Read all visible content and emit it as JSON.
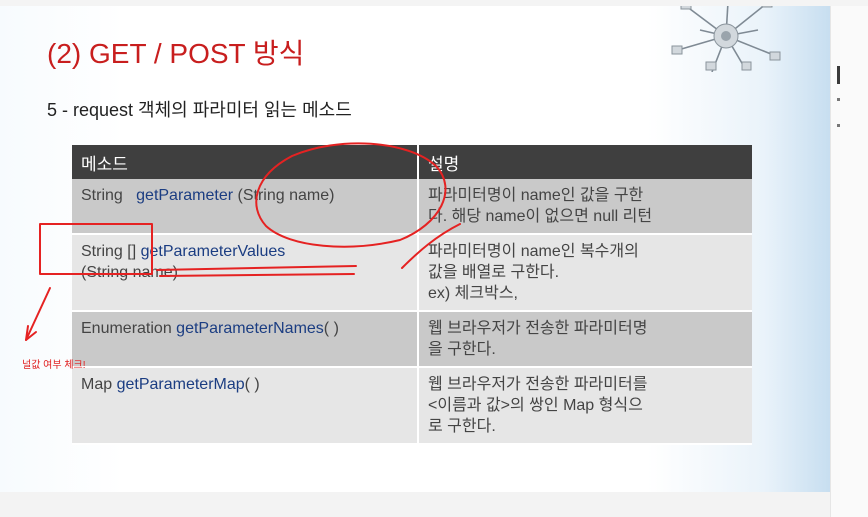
{
  "slide": {
    "title": "(2) GET / POST 방식",
    "subtitle": "5 - request 객체의 파라미터 읽는 메소드"
  },
  "table": {
    "headers": [
      "메소드",
      "설명"
    ],
    "rows": [
      {
        "type": "String",
        "name": "getParameter",
        "params": "(String name)",
        "desc": [
          "파라미터명이 name인 값을 구한",
          "다. 해당 name이 없으면 null 리턴"
        ]
      },
      {
        "type": "String []",
        "name": "getParameterValues",
        "params": "(String name)",
        "desc": [
          "파라미터명이 name인  복수개의",
          "값을 배열로 구한다.",
          "ex) 체크박스,"
        ]
      },
      {
        "type": "Enumeration",
        "name": "getParameterNames",
        "params": "( )",
        "desc": [
          "웹 브라우저가 전송한 파라미터명",
          "을 구한다."
        ]
      },
      {
        "type": "Map",
        "name": "getParameterMap",
        "params": "( )",
        "desc": [
          "웹 브라우저가 전송한 파라미터를",
          "<이름과 값>의 쌍인 Map 형식으",
          "로 구한다."
        ]
      }
    ]
  },
  "annotation": {
    "note": "널값 여부 체크!",
    "ink_color": "#e52222"
  }
}
